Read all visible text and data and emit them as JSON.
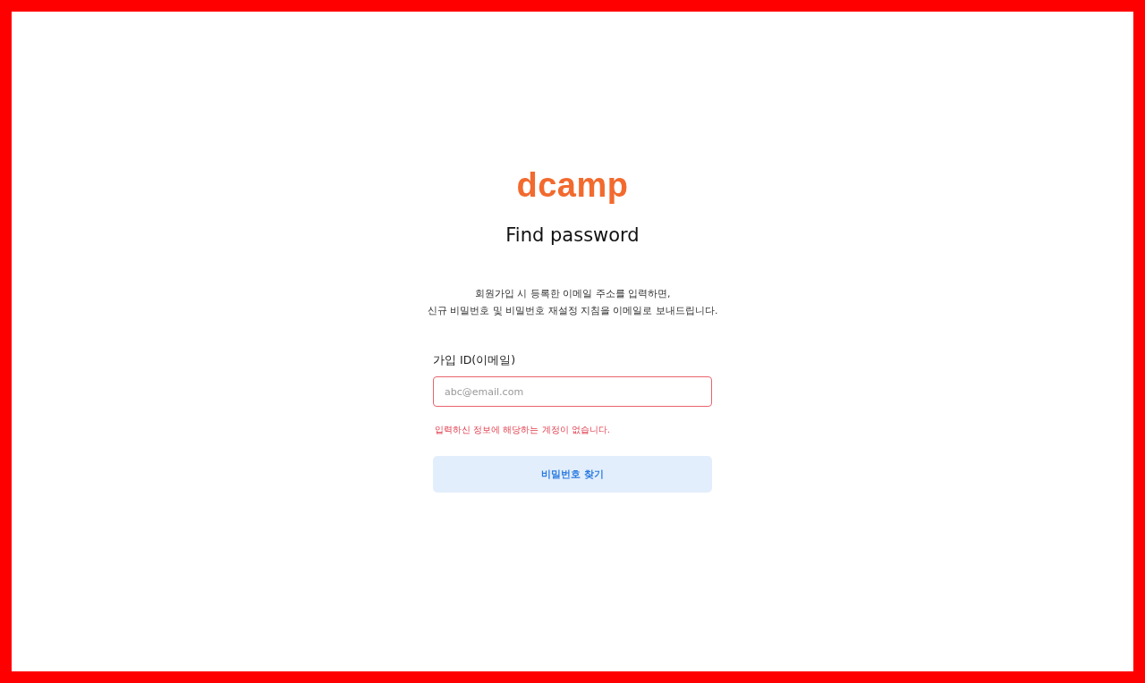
{
  "logo": "dcamp",
  "title": "Find password",
  "description": [
    "회원가입 시 등록한 이메일 주소를 입력하면,",
    "신규 비밀번호 및 비밀번호 재설정 지침을 이메일로 보내드립니다."
  ],
  "email_field": {
    "label": "가입 ID(이메일)",
    "placeholder": "abc@email.com",
    "error": true,
    "error_message": "입력하신 정보에 해당하는 계정이 없습니다."
  },
  "submit_button": {
    "label": "비밀번호 찾기",
    "disabled": true
  }
}
